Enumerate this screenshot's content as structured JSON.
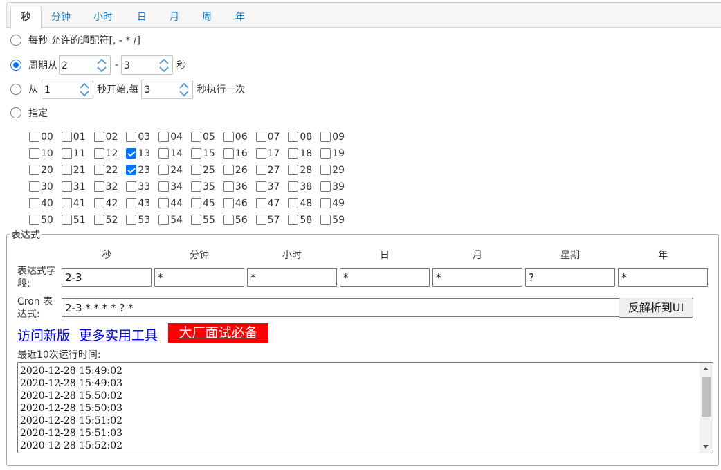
{
  "tabs": [
    "秒",
    "分钟",
    "小时",
    "日",
    "月",
    "周",
    "年"
  ],
  "options": {
    "every": "每秒 允许的通配符[, - * /]",
    "cycle_prefix": "周期从",
    "cycle_from": "2",
    "cycle_sep": "-",
    "cycle_to": "3",
    "cycle_suffix": "秒",
    "from_prefix": "从",
    "from_start": "1",
    "from_mid": "秒开始,每",
    "from_every": "3",
    "from_suffix": "秒执行一次",
    "specify": "指定"
  },
  "selected_option": "cycle",
  "seconds": [
    "00",
    "01",
    "02",
    "03",
    "04",
    "05",
    "06",
    "07",
    "08",
    "09",
    "10",
    "11",
    "12",
    "13",
    "14",
    "15",
    "16",
    "17",
    "18",
    "19",
    "20",
    "21",
    "22",
    "23",
    "24",
    "25",
    "26",
    "27",
    "28",
    "29",
    "30",
    "31",
    "32",
    "33",
    "34",
    "35",
    "36",
    "37",
    "38",
    "39",
    "40",
    "41",
    "42",
    "43",
    "44",
    "45",
    "46",
    "47",
    "48",
    "49",
    "50",
    "51",
    "52",
    "53",
    "54",
    "55",
    "56",
    "57",
    "58",
    "59"
  ],
  "checked_seconds": [
    "13",
    "23"
  ],
  "expression": {
    "legend": "表达式",
    "columns": [
      "秒",
      "分钟",
      "小时",
      "日",
      "月",
      "星期",
      "年"
    ],
    "field_label": "表达式字段:",
    "values": [
      "2-3",
      "*",
      "*",
      "*",
      "*",
      "?",
      "*"
    ],
    "cron_label": "Cron 表达式:",
    "cron_value": "2-3 * * * * ? *",
    "parse_button": "反解析到UI"
  },
  "links": {
    "new_version": "访问新版",
    "more_tools": "更多实用工具",
    "interview": "大厂面试必备"
  },
  "runtimes_label": "最近10次运行时间:",
  "runtimes": [
    "2020-12-28 15:49:02",
    "2020-12-28 15:49:03",
    "2020-12-28 15:50:02",
    "2020-12-28 15:50:03",
    "2020-12-28 15:51:02",
    "2020-12-28 15:51:03",
    "2020-12-28 15:52:02"
  ]
}
